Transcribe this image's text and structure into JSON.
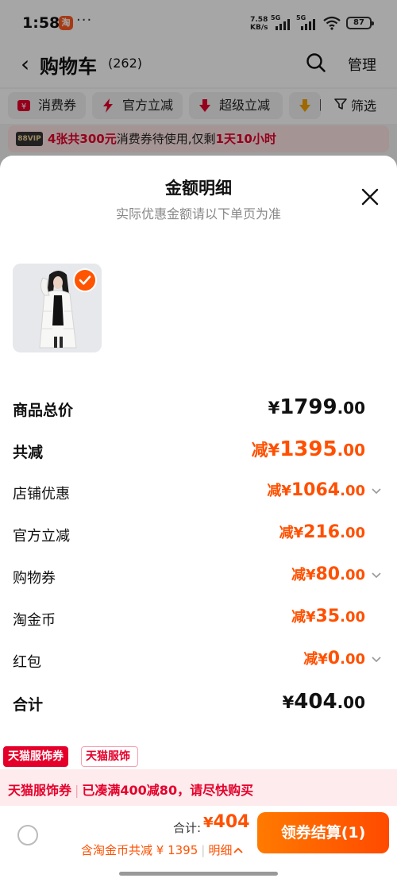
{
  "status_bar": {
    "time": "1:58",
    "app_badge": "淘",
    "more": "···",
    "net_speed_value": "7.58",
    "net_speed_unit": "KB/s",
    "sim1": "5G",
    "sim2": "5G",
    "battery": "87"
  },
  "cart_header": {
    "title": "购物车",
    "count": "(262)",
    "manage": "管理"
  },
  "filters": {
    "items": [
      {
        "label": "消费券",
        "icon": "coupon-icon"
      },
      {
        "label": "官方立减",
        "icon": "lightning-icon"
      },
      {
        "label": "超级立减",
        "icon": "down-arrow-icon"
      },
      {
        "label": "降",
        "icon": "price-drop-icon"
      }
    ],
    "filter_label": "筛选"
  },
  "coupon_banner": {
    "vip": "88VIP",
    "lead": "4张共300元",
    "mid": "消费券待使用,仅剩",
    "time_left": "1天10小时"
  },
  "sheet": {
    "title": "金额明细",
    "subtitle": "实际优惠金额请以下单页为准",
    "rows": [
      {
        "label": "商品总价",
        "prefix": "¥",
        "int": "1799",
        "dec": ".00"
      },
      {
        "label": "共减",
        "prefix": "减¥",
        "int": "1395",
        "dec": ".00"
      },
      {
        "label": "店铺优惠",
        "prefix": "减¥",
        "int": "1064",
        "dec": ".00"
      },
      {
        "label": "官方立减",
        "prefix": "减¥",
        "int": "216",
        "dec": ".00"
      },
      {
        "label": "购物券",
        "prefix": "减¥",
        "int": "80",
        "dec": ".00"
      },
      {
        "label": "淘金币",
        "prefix": "减¥",
        "int": "35",
        "dec": ".00"
      },
      {
        "label": "红包",
        "prefix": "减¥",
        "int": "0",
        "dec": ".00"
      },
      {
        "label": "合计",
        "prefix": "¥",
        "int": "404",
        "dec": ".00"
      }
    ]
  },
  "tags": {
    "tag_a": "天猫服饰券",
    "tag_b": "天猫服饰"
  },
  "promo": {
    "brand": "天猫服饰券",
    "sep": "|",
    "message": "已凑满400减80，请尽快购买"
  },
  "checkout": {
    "total_label": "合计:",
    "total_currency": "¥",
    "total_value": "404",
    "detail_text": "含淘金币共减 ¥ 1395",
    "detail_sep": "|",
    "detail_link": "明细",
    "button": "领券结算(1)"
  },
  "colors": {
    "accent": "#ff5000",
    "red": "#e5002b"
  }
}
